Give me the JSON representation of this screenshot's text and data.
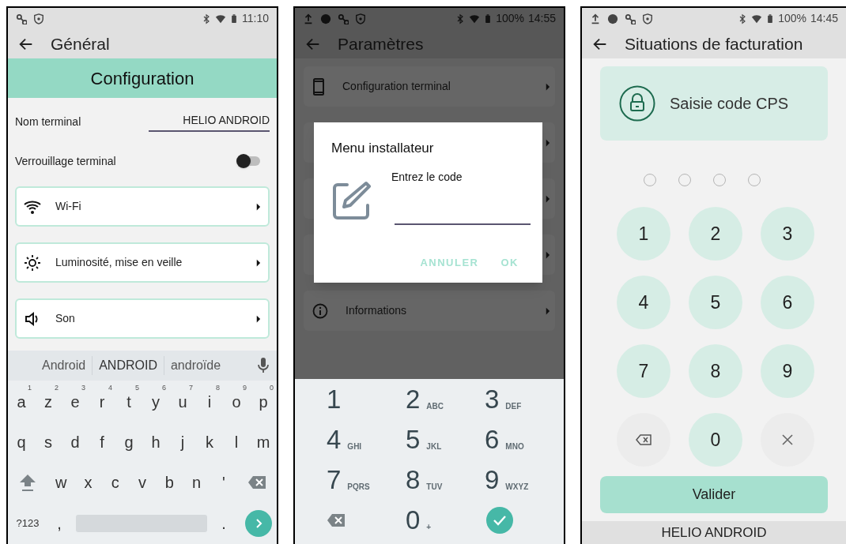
{
  "general_screen": {
    "status_bar": {
      "time": "11:10"
    },
    "header": {
      "title": "Général"
    },
    "section_title": "Configuration",
    "name_field": {
      "label": "Nom terminal",
      "value": "HELIO ANDROID"
    },
    "lock_toggle": {
      "label": "Verrouillage terminal",
      "on": false
    },
    "menu_items": [
      {
        "label": "Wi-Fi"
      },
      {
        "label": "Luminosité, mise en veille"
      },
      {
        "label": "Son"
      }
    ],
    "keyboard": {
      "suggestions": [
        "Android",
        "ANDROID",
        "androïde"
      ],
      "row_1": [
        {
          "key": "a",
          "hint": "1"
        },
        {
          "key": "z",
          "hint": "2"
        },
        {
          "key": "e",
          "hint": "3"
        },
        {
          "key": "r",
          "hint": "4"
        },
        {
          "key": "t",
          "hint": "5"
        },
        {
          "key": "y",
          "hint": "6"
        },
        {
          "key": "u",
          "hint": "7"
        },
        {
          "key": "i",
          "hint": "8"
        },
        {
          "key": "o",
          "hint": "9"
        },
        {
          "key": "p",
          "hint": "0"
        }
      ],
      "row_2": [
        "q",
        "s",
        "d",
        "f",
        "g",
        "h",
        "j",
        "k",
        "l",
        "m"
      ],
      "row_3": [
        "w",
        "x",
        "c",
        "v",
        "b",
        "n",
        "'"
      ],
      "symbols_key": "?123",
      "comma_key": ",",
      "period_key": "."
    }
  },
  "parametres_screen": {
    "status_bar": {
      "battery": "100%",
      "time": "14:55"
    },
    "header": {
      "title": "Paramètres"
    },
    "menu_items": [
      {
        "label": "Configuration terminal",
        "covered": false
      },
      {
        "covered": true
      },
      {
        "covered": true
      },
      {
        "covered": true
      },
      {
        "label": "Informations",
        "covered": false
      }
    ],
    "dialog": {
      "title": "Menu installateur",
      "prompt": "Entrez le code",
      "buttons": [
        "ANNULER",
        "OK"
      ]
    },
    "dialpad": [
      {
        "kind": "digit",
        "digit": "1"
      },
      {
        "kind": "digit",
        "digit": "2",
        "letters": "ABC"
      },
      {
        "kind": "digit",
        "digit": "3",
        "letters": "DEF"
      },
      {
        "kind": "digit",
        "digit": "4",
        "letters": "GHI"
      },
      {
        "kind": "digit",
        "digit": "5",
        "letters": "JKL"
      },
      {
        "kind": "digit",
        "digit": "6",
        "letters": "MNO"
      },
      {
        "kind": "digit",
        "digit": "7",
        "letters": "PQRS"
      },
      {
        "kind": "digit",
        "digit": "8",
        "letters": "TUV"
      },
      {
        "kind": "digit",
        "digit": "9",
        "letters": "WXYZ"
      },
      {
        "kind": "backspace"
      },
      {
        "kind": "digit",
        "digit": "0",
        "letters": "+"
      },
      {
        "kind": "done"
      }
    ]
  },
  "cps_screen": {
    "status_bar": {
      "battery": "100%",
      "time": "14:45"
    },
    "header": {
      "title": "Situations de facturation"
    },
    "banner": "Saisie code CPS",
    "pin_dots": [
      {
        "filled": false
      },
      {
        "filled": false
      },
      {
        "filled": false
      },
      {
        "filled": false
      }
    ],
    "keypad": [
      {
        "kind": "digit",
        "digit": "1"
      },
      {
        "kind": "digit",
        "digit": "2"
      },
      {
        "kind": "digit",
        "digit": "3"
      },
      {
        "kind": "digit",
        "digit": "4"
      },
      {
        "kind": "digit",
        "digit": "5"
      },
      {
        "kind": "digit",
        "digit": "6"
      },
      {
        "kind": "digit",
        "digit": "7"
      },
      {
        "kind": "digit",
        "digit": "8"
      },
      {
        "kind": "digit",
        "digit": "9"
      },
      {
        "kind": "backspace"
      },
      {
        "kind": "digit",
        "digit": "0"
      },
      {
        "kind": "clear"
      }
    ],
    "validate_button": "Valider",
    "footer": "HELIO ANDROID"
  }
}
